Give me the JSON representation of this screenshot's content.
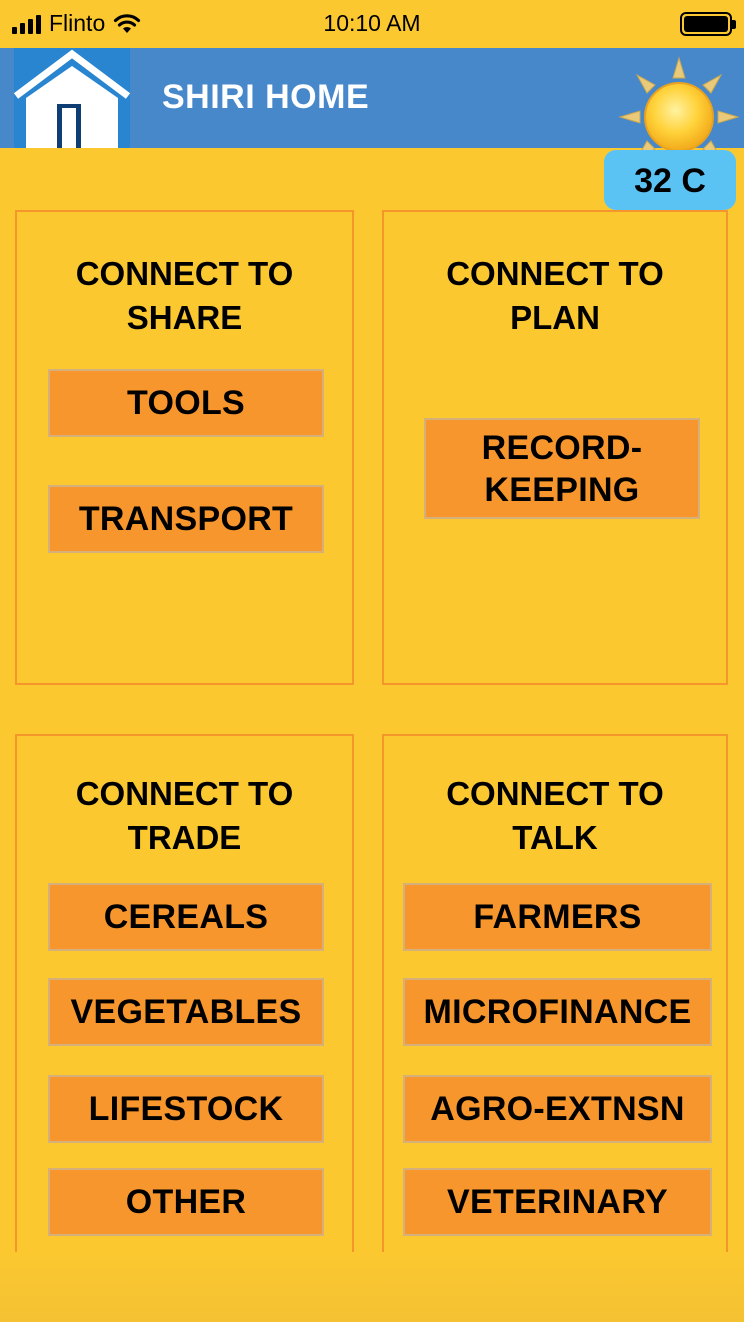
{
  "status_bar": {
    "carrier": "Flinto",
    "time": "10:10 AM",
    "signal_icon": "signal-bars-icon",
    "wifi_icon": "wifi-icon",
    "battery_icon": "battery-icon"
  },
  "header": {
    "title": "SHIRI HOME",
    "home_icon": "house-icon",
    "weather_icon": "sun-icon",
    "temperature": "32 C"
  },
  "colors": {
    "background": "#FBC830",
    "header": "#4788CB",
    "button": "#F7962D",
    "panel_border": "#F4962C",
    "temperature_badge": "#5BC3F4"
  },
  "panels": {
    "share": {
      "title": "CONNECT TO\nSHARE",
      "buttons": [
        "TOOLS",
        "TRANSPORT"
      ]
    },
    "plan": {
      "title": "CONNECT TO\nPLAN",
      "buttons": [
        "RECORD-\nKEEPING"
      ]
    },
    "trade": {
      "title": "CONNECT TO\nTRADE",
      "buttons": [
        "CEREALS",
        "VEGETABLES",
        "LIFESTOCK",
        "OTHER"
      ]
    },
    "talk": {
      "title": "CONNECT TO\nTALK",
      "buttons": [
        "FARMERS",
        "MICROFINANCE",
        "AGRO-EXTNSN",
        "VETERINARY"
      ]
    }
  }
}
